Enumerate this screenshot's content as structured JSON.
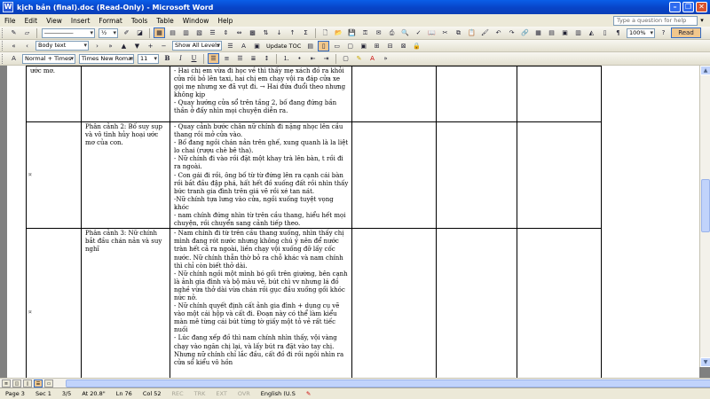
{
  "window": {
    "title": "kịch bản (final).doc (Read-Only) - Microsoft Word",
    "app_icon": "W"
  },
  "menu": {
    "items": [
      "File",
      "Edit",
      "View",
      "Insert",
      "Format",
      "Tools",
      "Table",
      "Window",
      "Help"
    ],
    "ask_placeholder": "Type a question for help"
  },
  "toolbar1": {
    "zoom": "100%",
    "read_label": "Read"
  },
  "toolbar2": {
    "style_value": "Body text",
    "show_all_levels": "Show All Levels",
    "update_toc": "Update TOC"
  },
  "toolbar3": {
    "style_value": "Normal + Times",
    "font_value": "Times New Roman",
    "size_value": "11"
  },
  "document": {
    "rows": [
      {
        "col1": "ước mơ.",
        "col2": "",
        "col3": "- Hai chị em vừa đi học về thì thấy mẹ xách đồ ra khỏi cửa rồi bỏ lên taxi, hai chị em chạy vội ra đáp cửa xe gọi mẹ nhưng xe đã vụt đi. → Hai đứa đuổi theo nhưng không kịp\n- Quay hướng cửa sổ trên tầng 2, bố đang đứng bần thần ở đấy nhìn mọi chuyện diễn ra."
      },
      {
        "col1": "",
        "col2": "Phân cảnh 2: Bố suy sụp và vô tình hủy hoại ước mơ của con.",
        "col3": "- Quay cảnh bước chân nữ chính đi nặng nhọc lên cầu thang rồi mở cửa vào.\n- Bố đang ngồi chán nản trên ghế, xung quanh là la liệt lo chai (rượu chè bê tha).\n- Nữ chính đi vào rồi đặt một khay trà lên bàn, t rồi đi ra ngoài.\n- Con gái đi rồi, ông bố từ từ đứng lên ra cạnh cái bàn rồi bắt đầu đập phá, hất hết đồ xuống đất rồi nhìn thấy bức tranh gia đình trên giá vẽ rồi xé tan nát.\n-Nữ chính tựa lưng vào cửa, ngồi xuống tuyệt vọng khóc\n- nam chính đứng nhìn từ trên cầu thang, hiểu hết mọi chuyện, rồi chuyển sang cảnh tiếp theo."
      },
      {
        "col1": "",
        "col2": "Phân cảnh 3: Nữ chính bắt đầu chán nản và suy nghĩ",
        "col3": "   - Nam chính đi từ trên cầu thang xuống, nhìn thấy chị mình đang rót nước nhưng không chú ý nên để nước tràn hết cả ra ngoài, liền chạy vội xuống đỡ lấy cốc nước. Nữ chính thẫn thờ bỏ ra chỗ khác và nam chính thì chỉ còn biết thở dài.\n- Nữ chính ngồi một mình bó gối trên giường, bên cạnh là ảnh gia đình và bộ màu vẽ, bút chì vv nhưng lá đồ nghề  vừa thở dài vừa chán rồi gục đầu xuống gối khóc nức nở.\n- Nữ chính quyết định cất ảnh gia đình + dụng cụ vẽ vào một cái hộp và cất đi. Đoạn này có thể làm kiểu màn mê từng cái bút từng tờ giấy một tỏ vẻ rất tiếc nuối\n- Lúc đang xếp đồ thì nam chính nhìn thấy, vội vàng chạy vào ngăn chị lại, và lấy bút ra đặt vào tay chị. Nhưng nữ chính chỉ lắc đầu, cất đồ đi rồi ngồi nhìn ra cửa sổ kiểu vô hồn"
      }
    ]
  },
  "status": {
    "page": "Page  3",
    "sec": "Sec  1",
    "pages": "3/5",
    "at": "At  20.8\"",
    "ln": "Ln  76",
    "col": "Col  52",
    "rec": "REC",
    "trk": "TRK",
    "ext": "EXT",
    "ovr": "OVR",
    "lang": "English (U.S"
  },
  "colors": {
    "titlebar": "#0844c8",
    "chrome": "#ece9d8",
    "pressed": "#f1c78d"
  },
  "icons": [
    "new-icon",
    "open-icon",
    "save-icon",
    "print-icon",
    "undo-icon",
    "redo-icon",
    "bold-icon",
    "italic-icon",
    "underline-icon",
    "align-left-icon",
    "align-center-icon",
    "align-right-icon",
    "justify-icon",
    "bullets-icon",
    "numbering-icon",
    "highlight-icon",
    "font-color-icon",
    "paragraph-mark-icon",
    "table-icon",
    "close-icon"
  ]
}
